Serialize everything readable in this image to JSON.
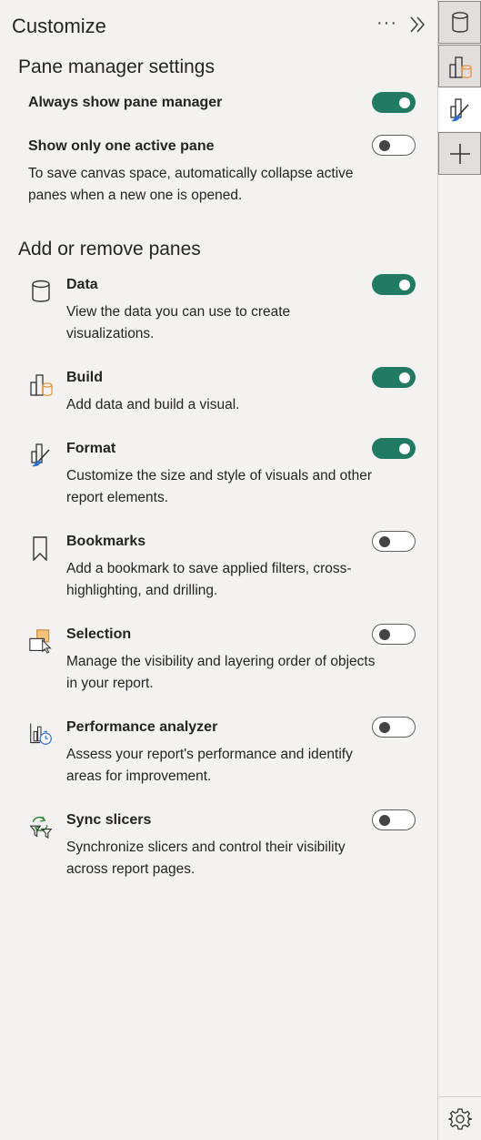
{
  "header": {
    "title": "Customize",
    "more_label": "···"
  },
  "pane_manager": {
    "title": "Pane manager settings",
    "always_show": {
      "label": "Always show pane manager",
      "on": true
    },
    "only_one": {
      "label": "Show only one active pane",
      "on": false,
      "description": "To save canvas space, automatically collapse active panes when a new one is opened."
    }
  },
  "add_remove": {
    "title": "Add or remove panes",
    "items": [
      {
        "icon": "data-cylinder-icon",
        "label": "Data",
        "description": "View the data you can use to create visualizations.",
        "on": true
      },
      {
        "icon": "build-visual-icon",
        "label": "Build",
        "description": "Add data and build a visual.",
        "on": true
      },
      {
        "icon": "format-brush-icon",
        "label": "Format",
        "description": "Customize the size and style of visuals and other report elements.",
        "on": true
      },
      {
        "icon": "bookmark-icon",
        "label": "Bookmarks",
        "description": "Add a bookmark to save applied filters, cross-highlighting, and drilling.",
        "on": false
      },
      {
        "icon": "selection-icon",
        "label": "Selection",
        "description": "Manage the visibility and layering order of objects in your report.",
        "on": false
      },
      {
        "icon": "performance-analyzer-icon",
        "label": "Performance analyzer",
        "description": "Assess your report's performance and identify areas for improvement.",
        "on": false
      },
      {
        "icon": "sync-slicers-icon",
        "label": "Sync slicers",
        "description": "Synchronize slicers and control their visibility across report pages.",
        "on": false
      }
    ]
  },
  "rail": [
    "data-cylinder-icon",
    "build-visual-icon",
    "format-brush-icon",
    "add-pane-icon",
    "settings-gear-icon"
  ],
  "colors": {
    "toggle_on": "#217a62",
    "accent_orange": "#e8953b",
    "accent_blue": "#2f6fd1",
    "accent_green": "#3a8c3a"
  }
}
